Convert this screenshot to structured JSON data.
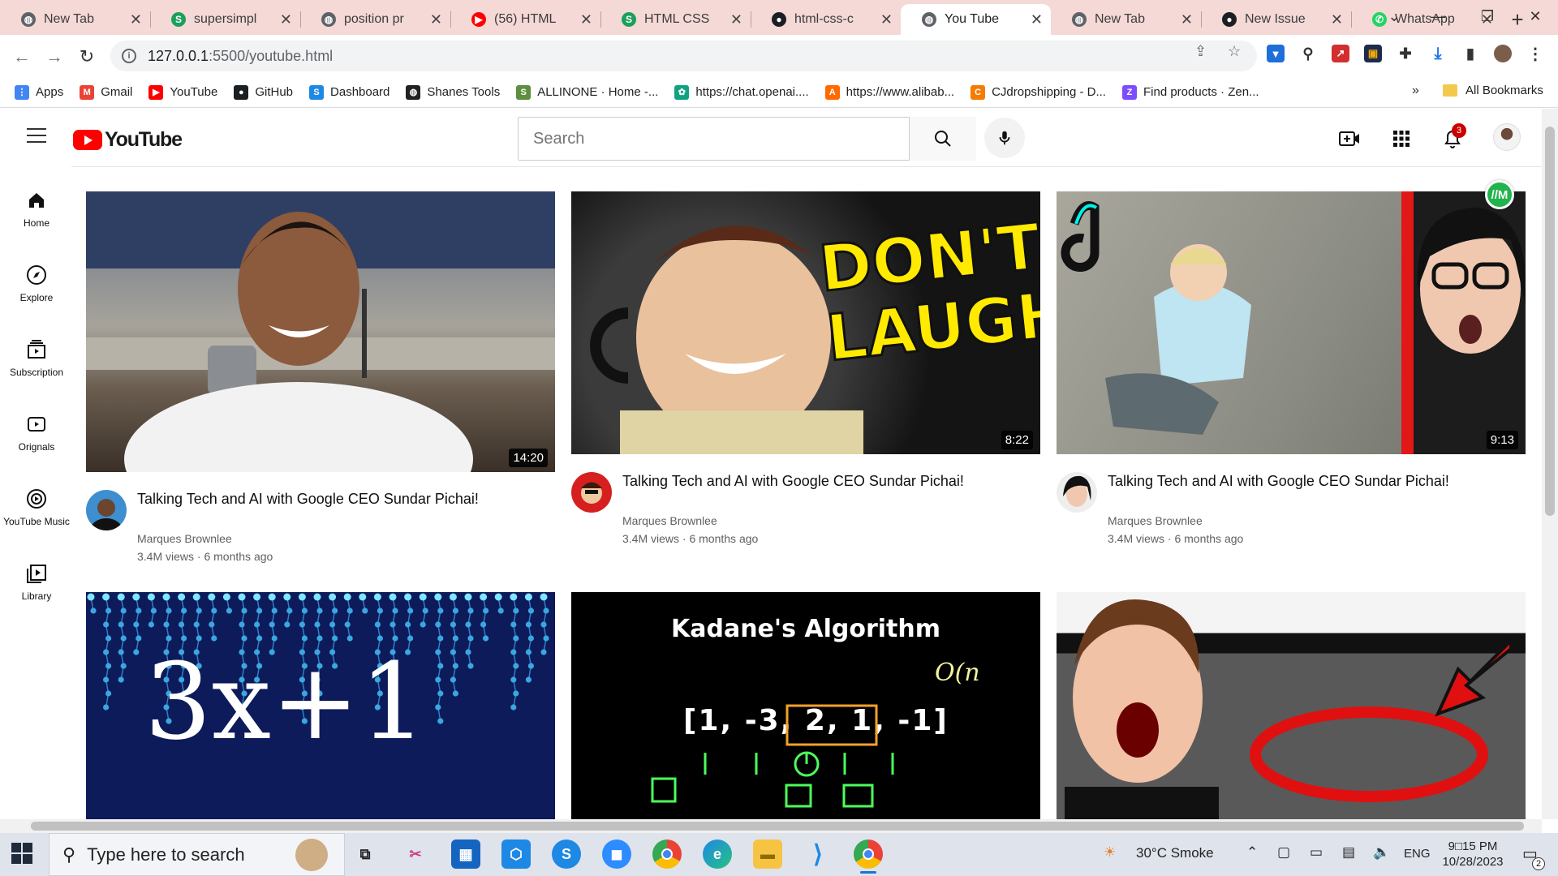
{
  "browser": {
    "tabs": [
      {
        "title": "New Tab",
        "icon": "globe-icon",
        "color": "#5f6368"
      },
      {
        "title": "supersimpl",
        "icon": "s-icon",
        "color": "#1aa05b"
      },
      {
        "title": "position pr",
        "icon": "globe-icon",
        "color": "#5f6368"
      },
      {
        "title": "(56) HTML",
        "icon": "youtube-icon",
        "color": "#ff0000"
      },
      {
        "title": "HTML CSS",
        "icon": "s-icon",
        "color": "#1aa05b"
      },
      {
        "title": "html-css-c",
        "icon": "github-icon",
        "color": "#1b1f23"
      },
      {
        "title": "You Tube",
        "icon": "globe-icon",
        "color": "#5f6368",
        "active": true
      },
      {
        "title": "New Tab",
        "icon": "globe-icon",
        "color": "#5f6368"
      },
      {
        "title": "New Issue",
        "icon": "github-icon",
        "color": "#1b1f23"
      },
      {
        "title": "WhatsApp",
        "icon": "whatsapp-icon",
        "color": "#25d366"
      }
    ],
    "url_host": "127.0.0.1",
    "url_path": ":5500/youtube.html",
    "bookmarks": [
      {
        "label": "Apps",
        "icon": "apps-grid-icon",
        "color": "#4285f4"
      },
      {
        "label": "Gmail",
        "icon": "gmail-icon",
        "color": "#ea4335"
      },
      {
        "label": "YouTube",
        "icon": "youtube-icon",
        "color": "#ff0000"
      },
      {
        "label": "GitHub",
        "icon": "github-icon",
        "color": "#1b1f23"
      },
      {
        "label": "Dashboard",
        "icon": "s-circle-icon",
        "color": "#1e88e5"
      },
      {
        "label": "Shanes Tools",
        "icon": "globe-icon",
        "color": "#222222"
      },
      {
        "label": "ALLINONE · Home -...",
        "icon": "shopify-icon",
        "color": "#5e8e3e"
      },
      {
        "label": "https://chat.openai....",
        "icon": "openai-icon",
        "color": "#10a37f"
      },
      {
        "label": "https://www.alibab...",
        "icon": "alibaba-icon",
        "color": "#ff6a00"
      },
      {
        "label": "CJdropshipping - D...",
        "icon": "cj-icon",
        "color": "#f57c00"
      },
      {
        "label": "Find products · Zen...",
        "icon": "zendrop-icon",
        "color": "#7c4dff"
      }
    ],
    "bookmarks_more": "»",
    "all_bookmarks": "All Bookmarks"
  },
  "youtube": {
    "logo_text": "YouTube",
    "search_placeholder": "Search",
    "notification_count": "3",
    "sidebar": [
      {
        "label": "Home",
        "icon": "home-icon"
      },
      {
        "label": "Explore",
        "icon": "compass-icon"
      },
      {
        "label": "Subscription",
        "icon": "subscriptions-icon"
      },
      {
        "label": "Orignals",
        "icon": "originals-icon"
      },
      {
        "label": "YouTube Music",
        "icon": "music-icon"
      },
      {
        "label": "Library",
        "icon": "library-icon"
      }
    ],
    "videos": [
      {
        "title": "Talking Tech and AI with Google CEO Sundar Pichai!",
        "channel": "Marques Brownlee",
        "stats": "3.4M views · 6 months ago",
        "duration": "14:20"
      },
      {
        "title": "Talking Tech and AI with Google CEO Sundar Pichai!",
        "channel": "Marques Brownlee",
        "stats": "3.4M views · 6 months ago",
        "duration": "8:22",
        "thumb_text_1": "DON'T",
        "thumb_text_2": "LAUGH"
      },
      {
        "title": "Talking Tech and AI with Google CEO Sundar Pichai!",
        "channel": "Marques Brownlee",
        "stats": "3.4M views · 6 months ago",
        "duration": "9:13"
      },
      {
        "thumb_text": "3x+1"
      },
      {
        "thumb_text": "Kadane's Algorithm",
        "array_text": "[1, -3, 2, 1, -1]",
        "complexity": "O(n"
      },
      {}
    ]
  },
  "taskbar": {
    "search_placeholder": "Type here to search",
    "weather": "30°C  Smoke",
    "language": "ENG",
    "time": "9□15 PM",
    "date": "10/28/2023",
    "notifications": "2"
  }
}
